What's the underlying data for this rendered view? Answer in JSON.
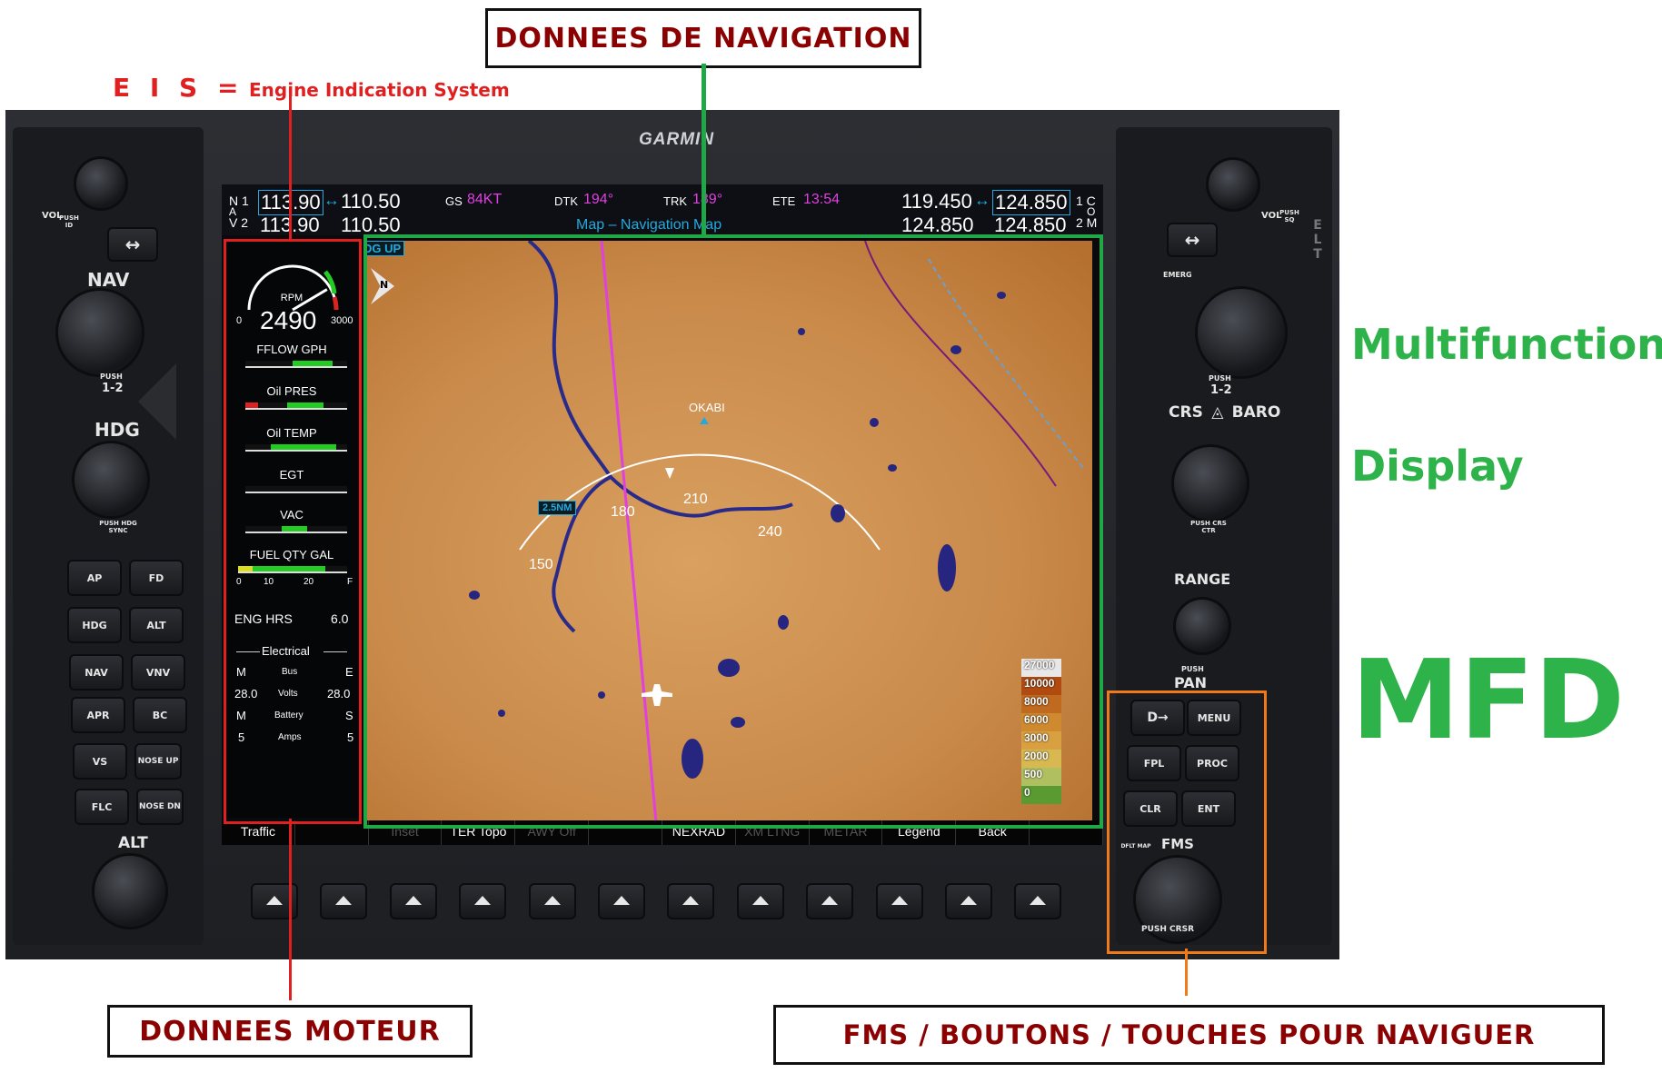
{
  "annotations": {
    "nav_data": "DONNEES DE NAVIGATION",
    "eis_abbr": "E I S =",
    "eis_full": "Engine Indication System",
    "engine_data": "DONNEES MOTEUR",
    "fms_buttons": "FMS / BOUTONS / TOUCHES POUR NAVIGUER",
    "side_line1": "Multifunction",
    "side_line2": "Display",
    "side_abbr": "MFD"
  },
  "colors": {
    "eis_box": "#e02020",
    "nav_box": "#1fa845",
    "fms_box": "#f07a1a",
    "green_label": "#2db34a",
    "dark_red_text": "#8b0000"
  },
  "brand": "GARMIN",
  "topbar": {
    "nav1_tag": "N 1",
    "nav2_tag": "V 2",
    "nav_mid": "A",
    "nav1_active": "113.90",
    "nav1_standby": "110.50",
    "nav2_active": "113.90",
    "nav2_standby": "110.50",
    "gs_label": "GS",
    "gs_value": "84KT",
    "dtk_label": "DTK",
    "dtk_value": "194°",
    "trk_label": "TRK",
    "trk_value": "189°",
    "ete_label": "ETE",
    "ete_value": "13:54",
    "com1_active": "119.450",
    "com1_standby": "124.850",
    "com2_active": "124.850",
    "com2_standby": "124.850",
    "com1_tag": "1 C",
    "com2_tag": "2 M",
    "com_mid": "O",
    "page_title": "Map – Navigation Map"
  },
  "eis": {
    "rpm_label": "RPM",
    "rpm_value": "2490",
    "rpm_min": "0",
    "rpm_max": "3000",
    "rpm_fraction": 0.83,
    "fflow_label": "FFLOW GPH",
    "oil_pres_label": "Oil PRES",
    "oil_temp_label": "Oil TEMP",
    "egt_label": "EGT",
    "vac_label": "VAC",
    "fuel_label": "FUEL QTY GAL",
    "fuel_ticks": [
      "0",
      "10",
      "20",
      "F"
    ],
    "eng_hrs_label": "ENG HRS",
    "eng_hrs_value": "6.0",
    "electrical_label": "Electrical",
    "bus_label": "Bus",
    "volts_label": "Volts",
    "battery_label": "Battery",
    "amps_label": "Amps",
    "m_label": "M",
    "e_label": "E",
    "s_label": "S",
    "volts_m": "28.0",
    "volts_e": "28.0",
    "amps_m": "5",
    "amps_s": "5"
  },
  "map": {
    "orientation": "DG UP",
    "north_mark": "N",
    "range_label": "2.5NM",
    "waypoint": "OKABI",
    "arc_labels": [
      "150",
      "180",
      "210",
      "240"
    ],
    "terrain_scale": [
      "27000",
      "10000",
      "8000",
      "6000",
      "3000",
      "2000",
      "500",
      "0"
    ],
    "terrain_colors": [
      "#e8e8e8",
      "#b04a10",
      "#c06a20",
      "#cf8a30",
      "#d8a040",
      "#d8b850",
      "#b0c060",
      "#5a9a30"
    ]
  },
  "softkeys": [
    {
      "label": "Traffic",
      "dim": false
    },
    {
      "label": "",
      "dim": false
    },
    {
      "label": "Inset",
      "dim": true
    },
    {
      "label": "TER Topo",
      "dim": false
    },
    {
      "label": "AWY Off",
      "dim": true
    },
    {
      "label": "",
      "dim": false
    },
    {
      "label": "NEXRAD",
      "dim": false
    },
    {
      "label": "XM LTNG",
      "dim": true
    },
    {
      "label": "METAR",
      "dim": true
    },
    {
      "label": "Legend",
      "dim": false
    },
    {
      "label": "Back",
      "dim": false
    },
    {
      "label": "",
      "dim": false
    }
  ],
  "left_panel": {
    "vol_label": "VOL",
    "vol_push": "PUSH ID",
    "nav_label": "NAV",
    "nav_push": "PUSH",
    "nav_12": "1-2",
    "hdg_label": "HDG",
    "hdg_push": "PUSH HDG SYNC",
    "alt_label": "ALT",
    "buttons": [
      "AP",
      "FD",
      "HDG",
      "ALT",
      "NAV",
      "VNV",
      "APR",
      "BC",
      "VS",
      "NOSE UP",
      "FLC",
      "NOSE DN"
    ]
  },
  "right_panel": {
    "vol_label": "VOL",
    "vol_push": "PUSH SQ",
    "emerg_label": "EMERG",
    "push_12": "PUSH",
    "label_12": "1-2",
    "crs_label": "CRS",
    "baro_label": "BARO",
    "crs_push": "PUSH CRS CTR",
    "range_label": "RANGE",
    "pan_push": "PUSH",
    "pan_label": "PAN",
    "direct_to": "D→",
    "menu": "MENU",
    "fpl": "FPL",
    "proc": "PROC",
    "clr": "CLR",
    "ent": "ENT",
    "dflt_map": "DFLT MAP",
    "fms_label": "FMS",
    "push_crsr": "PUSH CRSR",
    "elt": "ELT"
  }
}
